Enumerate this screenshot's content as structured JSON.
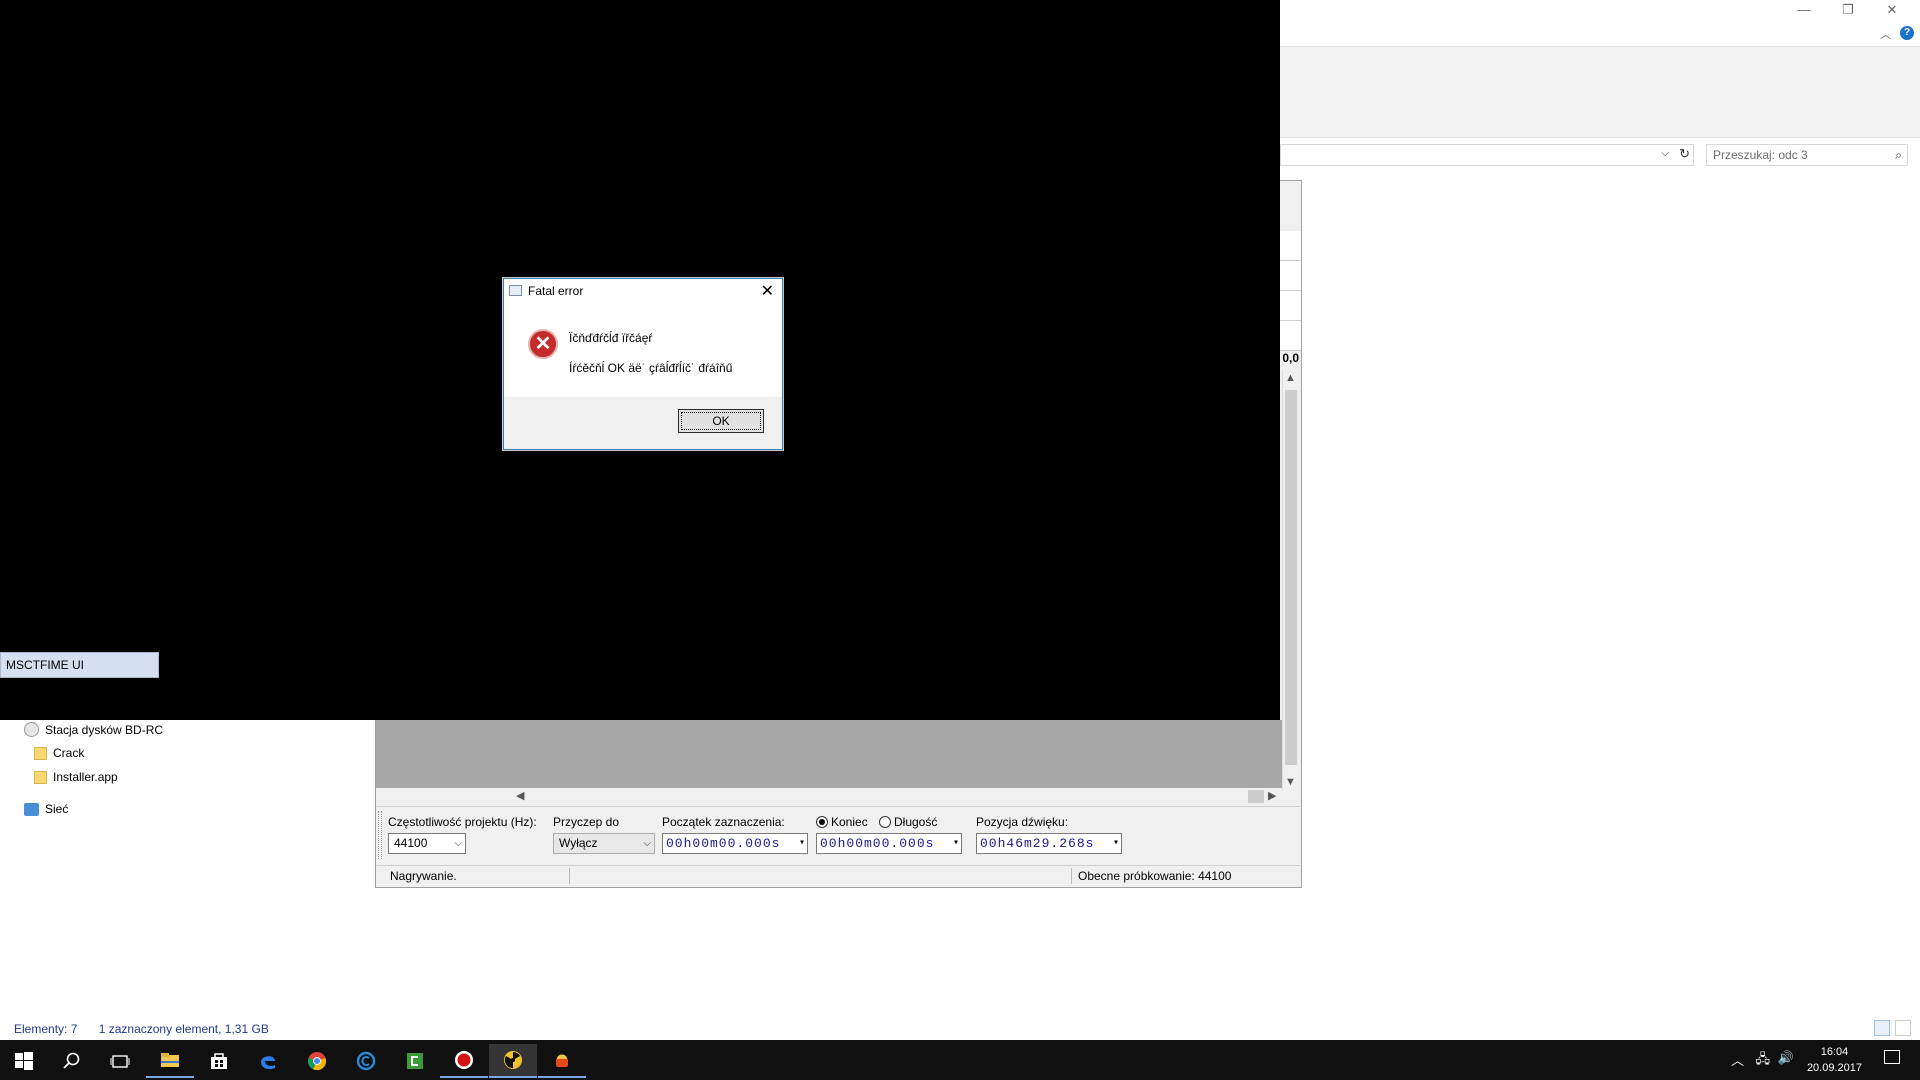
{
  "explorer": {
    "search_placeholder": "Przeszukaj: odc 3",
    "nav": {
      "drive": "Stacja dysków BD-RC",
      "folders": [
        "Crack",
        "Installer.app"
      ],
      "network": "Sieć"
    },
    "status": {
      "elements": "Elementy: 7",
      "selection": "1 zaznaczony element, 1,31 GB"
    },
    "help": "?"
  },
  "audio_app": {
    "time_label": "0,0",
    "controls": {
      "project_rate_label": "Częstotliwość projektu (Hz):",
      "project_rate_value": "44100",
      "snap_label": "Przyczep do",
      "snap_value": "Wyłącz",
      "selection_start_label": "Początek zaznaczenia:",
      "selection_start_value": "00h00m00.000s",
      "end_radio": "Koniec",
      "length_radio": "Długość",
      "end_value": "00h00m00.000s",
      "audio_position_label": "Pozycja dźwięku:",
      "audio_position_value": "00h46m29.268s"
    },
    "status": {
      "left": "Nagrywanie.",
      "right": "Obecne próbkowanie: 44100"
    }
  },
  "ime_window": "MSCTFIME UI",
  "dialog": {
    "title": "Fatal error",
    "line1": "Ïčňďđŕčĺđ ïřčáęŕ",
    "line2": "Íŕćěčňĺ OK äë˙ çŕâĺđřĺíč˙ đŕáîňű",
    "ok": "OK"
  },
  "taskbar": {
    "clock_time": "16:04",
    "clock_date": "20.09.2017",
    "icons": [
      "start",
      "search",
      "task-view",
      "file-explorer",
      "store",
      "edge",
      "chrome",
      "ccleaner",
      "camtasia",
      "recorder",
      "nuclear-app",
      "game-app"
    ]
  },
  "colors": {
    "accent": "#1a73c9",
    "error_red": "#c42b2b",
    "taskbar": "#101010",
    "time_digits": "#1a1a8c"
  }
}
